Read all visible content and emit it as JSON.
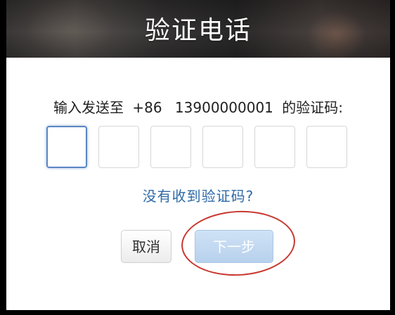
{
  "header": {
    "title": "验证电话"
  },
  "prompt": {
    "prefix": "输入发送至",
    "country_code": "+86",
    "phone": "13900000001",
    "suffix": "的验证码:"
  },
  "code_inputs": [
    "",
    "",
    "",
    "",
    "",
    ""
  ],
  "resend_link": "没有收到验证码?",
  "buttons": {
    "cancel": "取消",
    "next": "下一步"
  },
  "colors": {
    "link": "#2e6aa8",
    "next_button": "#c3d9f0",
    "annotation": "#c8372f",
    "focus": "#5a86c4"
  }
}
